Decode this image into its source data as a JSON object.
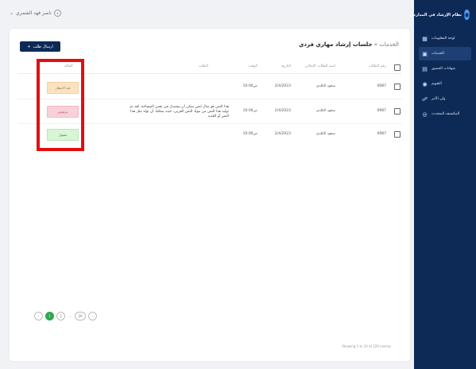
{
  "brand": {
    "title": "نظام الإرشاد في المدارس",
    "logo": "logo-icon"
  },
  "nav": [
    {
      "label": "لوحة المعلومات",
      "icon": "dashboard-icon",
      "glyph": "▦",
      "active": false
    },
    {
      "label": "الخدمات",
      "icon": "services-icon",
      "glyph": "▣",
      "active": true
    },
    {
      "label": "شهادات الحضور",
      "icon": "certificate-icon",
      "glyph": "▤",
      "active": false
    },
    {
      "label": "التقويم",
      "icon": "calendar-icon",
      "glyph": "◉",
      "active": false
    },
    {
      "label": "ولي الأمر",
      "icon": "guardian-icon",
      "glyph": "☍",
      "active": false
    },
    {
      "label": "المكتشف المتحدث",
      "icon": "explorer-icon",
      "glyph": "◎",
      "active": false
    }
  ],
  "user": {
    "name": "ناصر فهد الشمري",
    "chevron": "⌄",
    "avatar_glyph": "ℹ"
  },
  "page": {
    "breadcrumb_root": "الخدمات",
    "breadcrumb_separator": " » ",
    "title": "جلسات إرشاد مهاري فردي",
    "send_button": "ارسال طلب",
    "send_button_icon": "+"
  },
  "table": {
    "headers": {
      "id": "رقم الطالب",
      "student": "اسم الطالب الإملائي",
      "date": "التاريخ",
      "time": "الوقت",
      "request": "الطلب",
      "status": "الحالة"
    },
    "rows": [
      {
        "id": "0987",
        "student": "سعود الكلدي",
        "date": "2/4/2023",
        "time": "10:00ص",
        "request": "",
        "status": "قيد الانتظار",
        "status_type": "waiting"
      },
      {
        "id": "0987",
        "student": "سعود الكلدي",
        "date": "2/4/2023",
        "time": "10:00ص",
        "request": "هذا النص هو مثال لنص يمكن أن يستبدل في نفس المساحة، لقد تم توليد هذا النص من مولد النص العربي، حيث يمكنك أن تولد مثل هذا النص أو العديد",
        "status": "مرفوض",
        "status_type": "rejected"
      },
      {
        "id": "0987",
        "student": "سعود الكلدي",
        "date": "2/4/2023",
        "time": "10:00ص",
        "request": "",
        "status": "مقبول",
        "status_type": "accepted"
      }
    ]
  },
  "footer": {
    "summary": "Showing 1 to 10 of 229 entries",
    "pages": [
      "‹",
      "1",
      "2",
      "...",
      "20",
      "›"
    ],
    "active_page": "1"
  },
  "colors": {
    "sidebar": "#0d2a57",
    "highlight": "#e01010",
    "active_page": "#2fa84f"
  }
}
